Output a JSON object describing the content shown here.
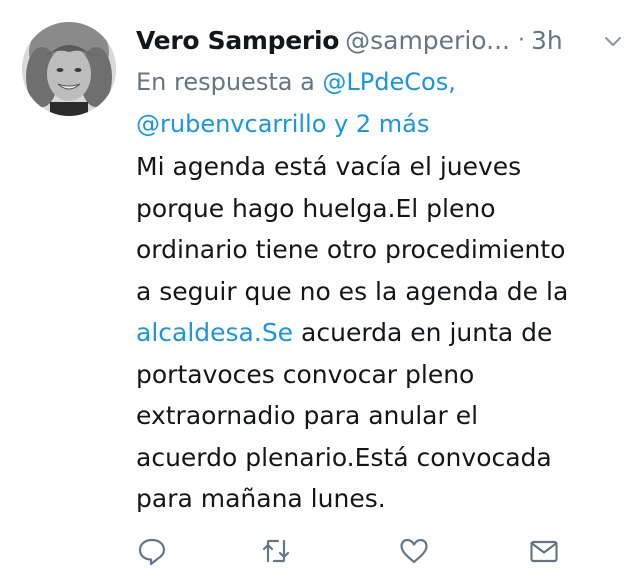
{
  "author": {
    "display_name": "Vero Samperio",
    "handle": "@samperio...",
    "separator": "·",
    "time": "3h"
  },
  "reply": {
    "prefix": "En respuesta a",
    "mention_1": "@LPdeCos,",
    "mention_2": "@rubenvcarrillo",
    "suffix": "y 2 más"
  },
  "tweet": {
    "line_1": "Mi agenda está vacía el jueves",
    "line_2": "porque hago huelga.El pleno",
    "line_3": "ordinario tiene otro procedimiento",
    "line_4": "a seguir que no es la agenda de la",
    "line_5_link": "alcaldesa.Se",
    "line_5_rest": "acuerda en junta de",
    "line_6": "portavoces convocar pleno",
    "line_7": "extraornadio para anular el",
    "line_8": "acuerdo plenario.Está convocada",
    "line_9": "para mañana lunes."
  },
  "icons": {
    "menu": "chevron-down-icon",
    "reply": "reply-icon",
    "retweet": "retweet-icon",
    "like": "heart-icon",
    "message": "envelope-icon"
  },
  "colors": {
    "text": "#14171a",
    "secondary": "#657786",
    "link": "#1b95e0",
    "background": "#ffffff"
  }
}
